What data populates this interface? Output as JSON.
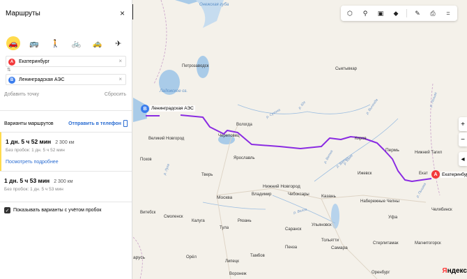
{
  "panel": {
    "title": "Маршруты",
    "close_icon": "×",
    "modes": [
      {
        "name": "car-icon",
        "glyph": "🚗",
        "active": true
      },
      {
        "name": "bus-icon",
        "glyph": "🚌",
        "active": false
      },
      {
        "name": "pedestrian-icon",
        "glyph": "🚶",
        "active": false
      },
      {
        "name": "bicycle-icon",
        "glyph": "🚲",
        "active": false
      },
      {
        "name": "taxi-icon",
        "glyph": "🚕",
        "active": false
      },
      {
        "name": "plane-icon",
        "glyph": "✈",
        "active": false
      }
    ],
    "point_a": {
      "marker": "A",
      "value": "Екатеринбург",
      "clear": "×"
    },
    "point_b": {
      "marker": "В",
      "value": "Ленинградская АЭС",
      "clear": "×"
    },
    "swap_icon": "⇅",
    "add_point": "Добавить точку",
    "reset": "Сбросить",
    "variants_label": "Варианты маршрутов",
    "send_phone": "Отправить в телефон",
    "routes": [
      {
        "time": "1 дн. 5 ч 52 мин",
        "distance": "2 300 км",
        "no_traffic": "Без пробок: 1 дн. 5 ч 52 мин",
        "details": "Посмотреть подробнее"
      },
      {
        "time": "1 дн. 5 ч 53 мин",
        "distance": "2 300 км",
        "no_traffic": "Без пробок: 1 дн. 5 ч 53 мин"
      }
    ],
    "traffic_checkbox": "Показывать варианты с учётом пробок",
    "collapse_icon": "◀"
  },
  "map": {
    "toolbar": [
      {
        "name": "layers-traffic-icon",
        "glyph": "⬡"
      },
      {
        "name": "bicycle-layer-icon",
        "glyph": "⚲"
      },
      {
        "name": "transit-layer-icon",
        "glyph": "▣"
      },
      {
        "name": "map-layers-icon",
        "glyph": "◆"
      },
      {
        "name": "ruler-icon",
        "glyph": "✎"
      },
      {
        "name": "print-icon",
        "glyph": "⎙"
      },
      {
        "name": "menu-icon",
        "glyph": "="
      }
    ],
    "zoom_in": "+",
    "zoom_out": "−",
    "compass": "◂",
    "start_label": "Ленинградская АЭС",
    "start_marker": "В",
    "end_label": "Екатеринбург",
    "end_marker": "A",
    "end_short": "Екат",
    "route_color": "#8a2be2",
    "cities": {
      "onega_bay": "Онежская губа",
      "petrozavodsk": "Петрозаводск",
      "ladoga": "Ладожское оз.",
      "syktyvkar": "Сыктывкар",
      "vologda": "Вологда",
      "cherepovets": "Череповец",
      "velikiy_novgorod": "Великий Новгород",
      "pskov": "Псков",
      "yaroslavl": "Ярославль",
      "tver": "Тверь",
      "kirov": "Киров",
      "perm": "Пермь",
      "nizhniy_tagil": "Нижний Тагил",
      "izhevsk": "Ижевск",
      "nizhniy_novgorod": "Нижний Новгород",
      "vladimir": "Владимир",
      "cheboksary": "Чебоксары",
      "kazan": "Казань",
      "naberezhnye": "Набережные Челны",
      "moscow": "Москва",
      "ryazan": "Рязань",
      "vitebsk": "Витебск",
      "smolensk": "Смоленск",
      "kaluga": "Калуга",
      "tula": "Тула",
      "saransk": "Саранск",
      "ulyanovsk": "Ульяновск",
      "ufa": "Уфа",
      "chelyabinsk": "Челябинск",
      "magnitogorsk": "Магнитогорск",
      "sterlitamak": "Стерлитамак",
      "tolyatti": "Тольятти",
      "samara": "Самара",
      "penza": "Пенза",
      "tambov": "Тамбов",
      "lipetsk": "Липецк",
      "oryol": "Орёл",
      "voronezh": "Воронеж",
      "orenburg": "Оренбург",
      "belarus": "арусь"
    },
    "rivers": {
      "suhona": "р. Сухона",
      "yug": "р. Юг",
      "vyatka": "р. Вятка",
      "kama": "р. Кама",
      "volga": "р. Волга",
      "oka": "р. Ока",
      "vyatka2": "р. Вятка",
      "lozva": "р. Лозьва",
      "pyshma": "р. Пышма",
      "vychegda": "р. Вычегда",
      "ob": "р. Обь",
      "lugа": "р. Луга"
    },
    "logo_y": "Я",
    "logo_rest": "ндекс"
  }
}
